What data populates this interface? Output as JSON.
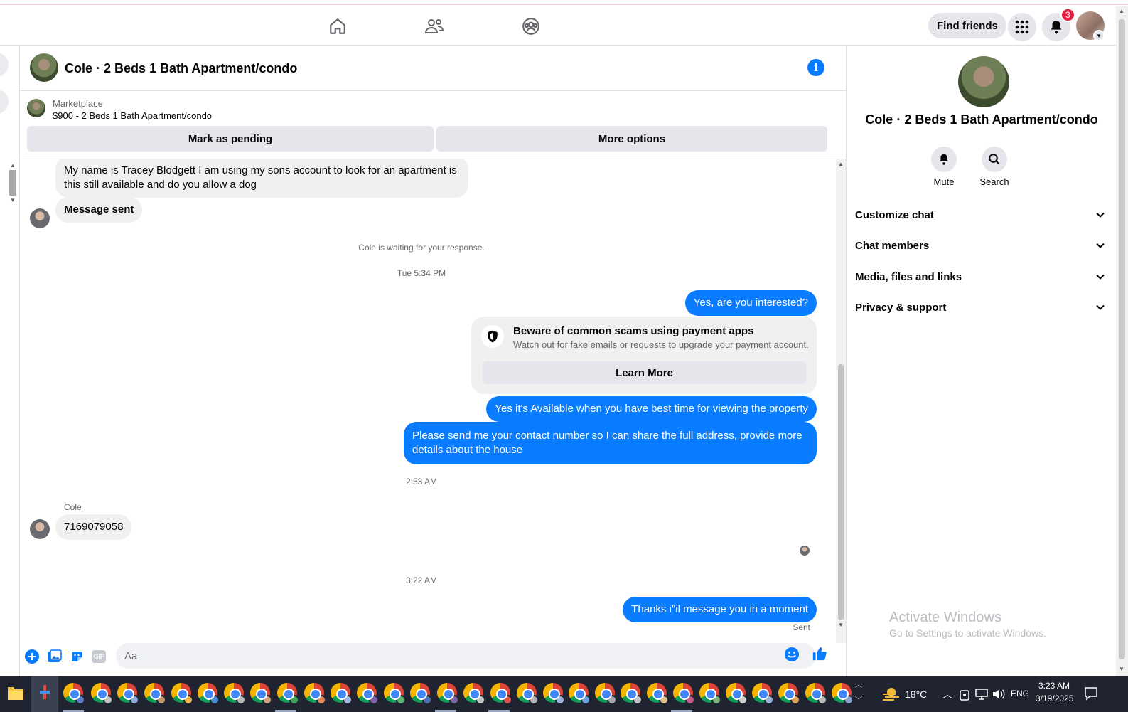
{
  "topnav": {
    "find_friends_label": "Find friends",
    "notification_count": "3"
  },
  "chat": {
    "title": "Cole · 2 Beds 1 Bath Apartment/condo"
  },
  "marketplace": {
    "label": "Marketplace",
    "listing": "$900 - 2 Beds 1 Bath Apartment/condo",
    "mark_pending_label": "Mark as pending",
    "more_options_label": "More options"
  },
  "messages": {
    "msg1": "My name is Tracey Blodgett I am using my sons account to look for an apartment is this still available and do you allow a dog",
    "msg2": "Message sent",
    "waiting_note": "Cole is waiting for your response.",
    "time1": "Tue 5:34 PM",
    "msg3": "Yes, are you interested?",
    "scam_title": "Beware of common scams using payment apps",
    "scam_body": "Watch out for fake emails or requests to upgrade your payment account.",
    "learn_more_label": "Learn More",
    "msg4": "Yes it's Available when you have best time for viewing the property",
    "msg5": "Please send me your contact number so I can share the full address, provide more details about the house",
    "time2": "2:53 AM",
    "sender_name": "Cole",
    "msg6": "7169079058",
    "time3": "3:22 AM",
    "msg7": "Thanks i\"il message you in a moment",
    "status": "Sent"
  },
  "composer": {
    "placeholder": "Aa",
    "gif_label": "GIF"
  },
  "right_pane": {
    "title": "Cole · 2 Beds 1 Bath Apartment/condo",
    "mute_label": "Mute",
    "search_label": "Search",
    "sections": [
      "Customize chat",
      "Chat members",
      "Media, files and links",
      "Privacy & support"
    ]
  },
  "watermark": {
    "line1": "Activate Windows",
    "line2": "Go to Settings to activate Windows."
  },
  "taskbar": {
    "temperature": "18°C",
    "language": "ENG",
    "time": "3:23 AM",
    "date": "3/19/2025"
  },
  "colors": {
    "accent": "#0a7cff",
    "incoming_bubble": "#f0f0f0",
    "notification_badge": "#e41e3f",
    "taskbar": "#1f2430"
  }
}
